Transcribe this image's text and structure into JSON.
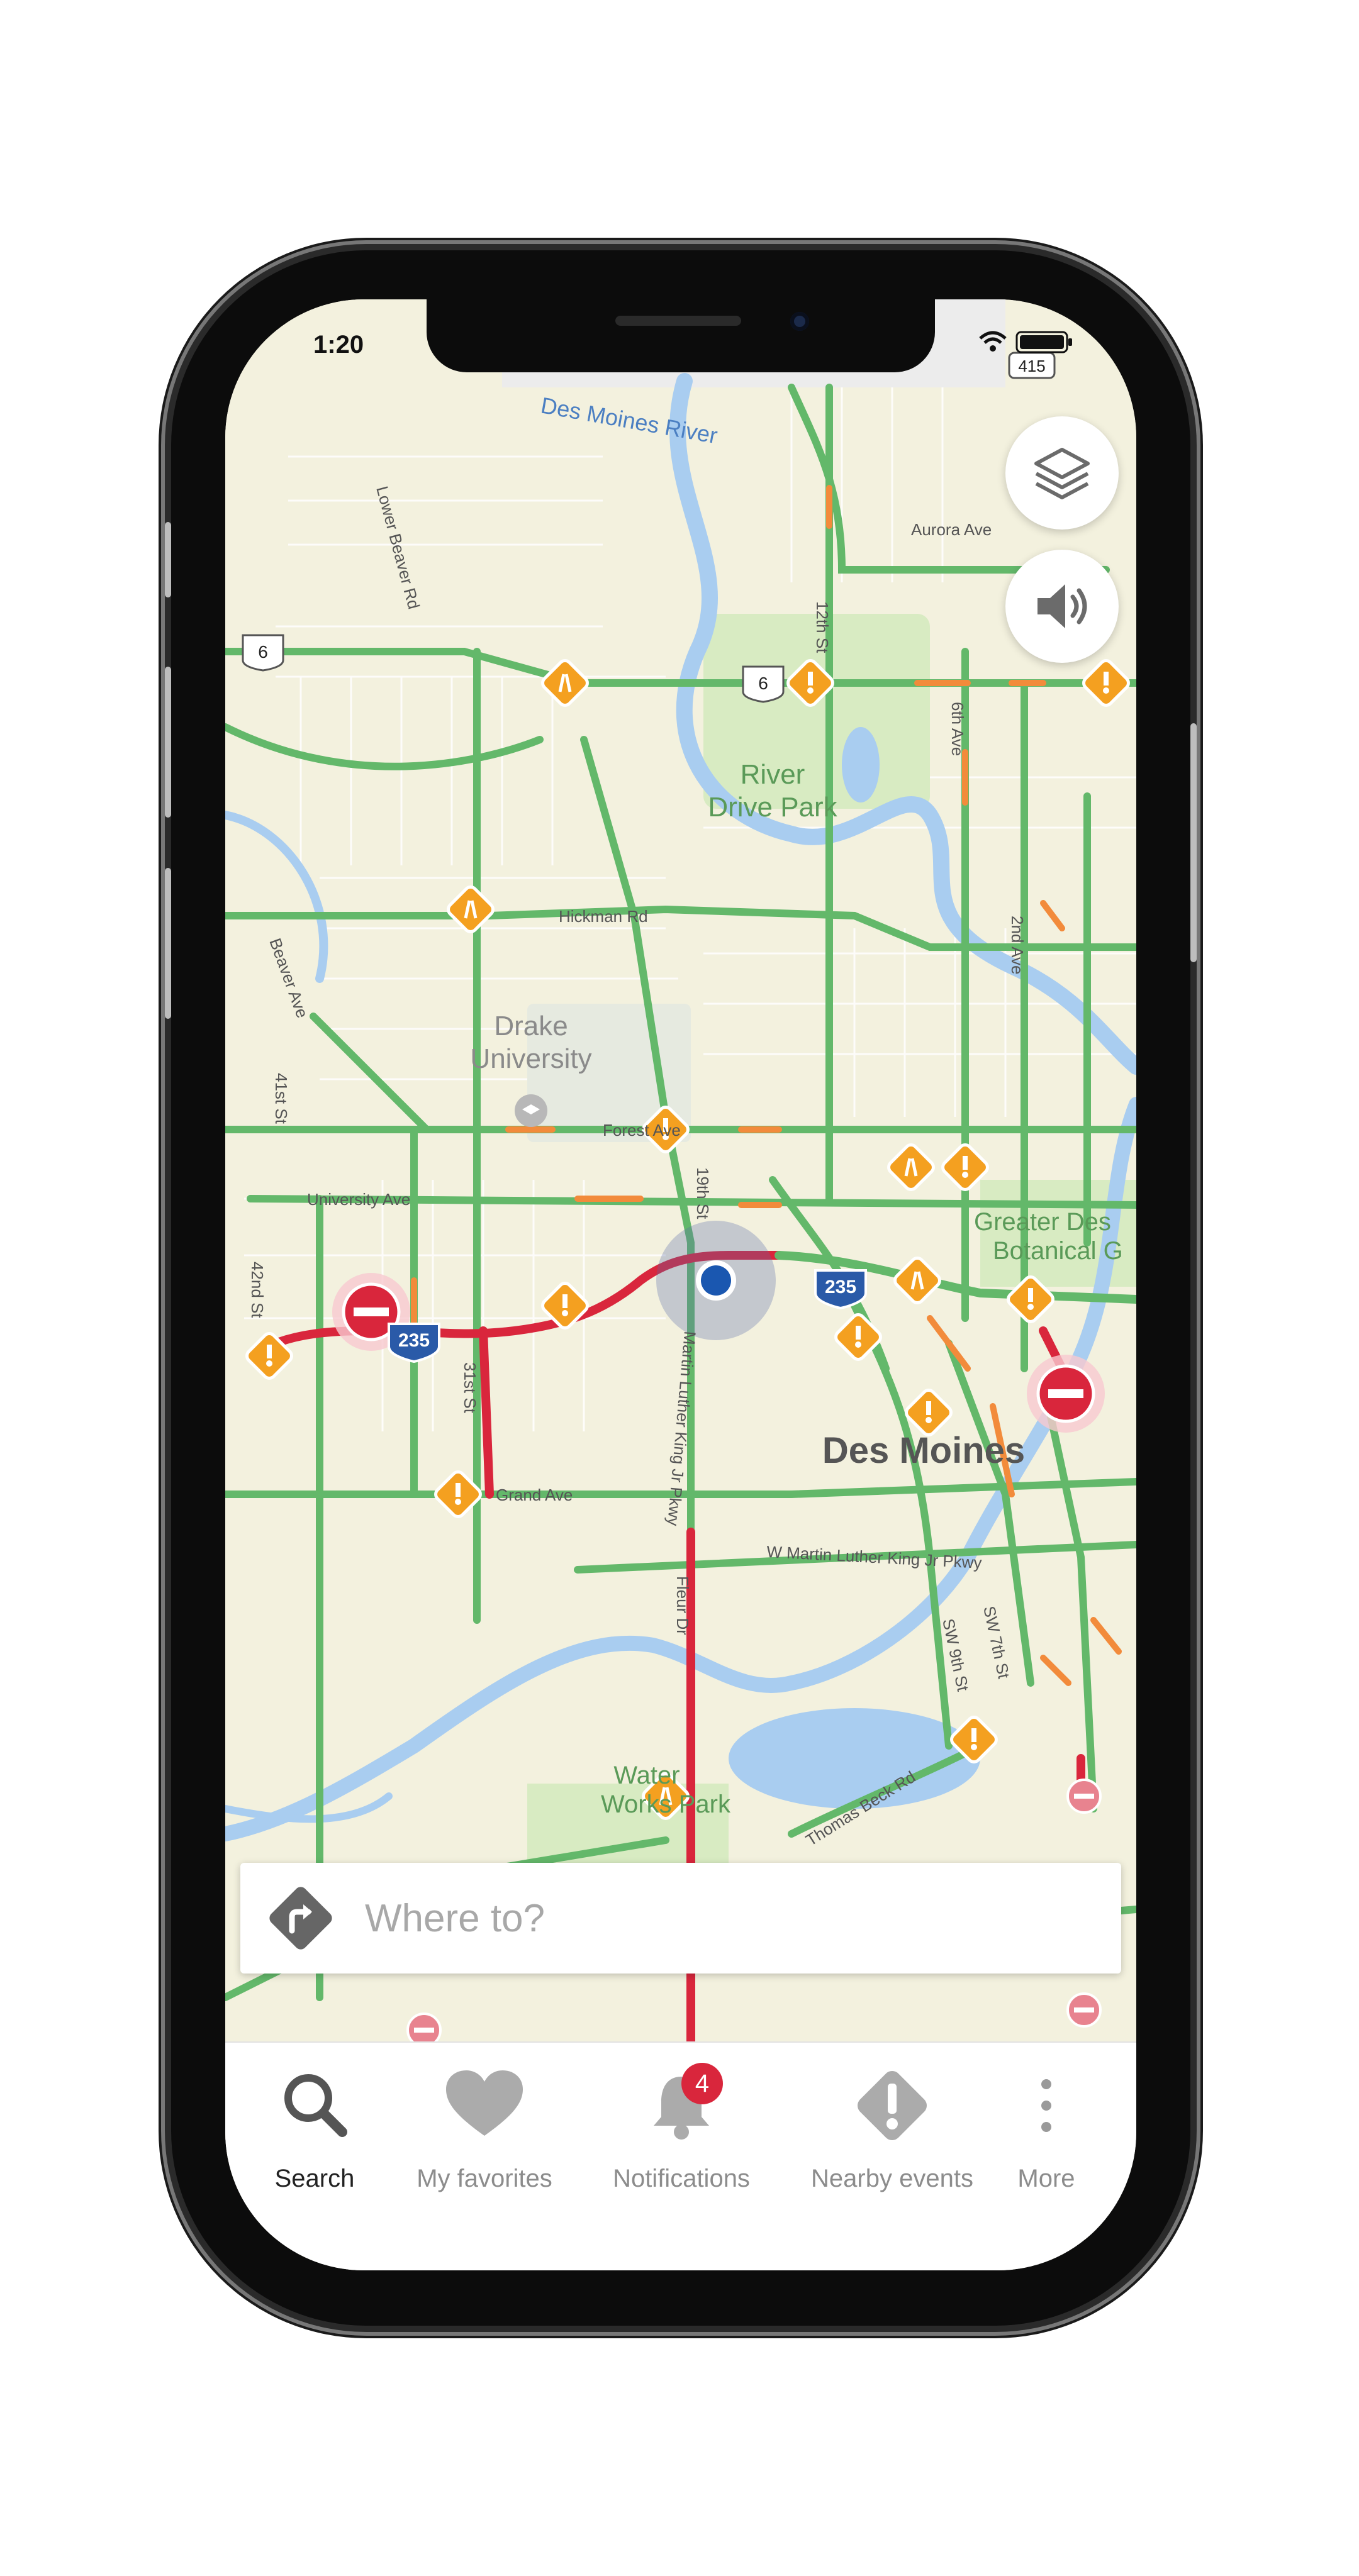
{
  "status_bar": {
    "time": "1:20"
  },
  "map": {
    "labels": {
      "river": "Des Moines River",
      "park1": "River",
      "park1b": "Drive Park",
      "univ1": "Drake",
      "univ1b": "University",
      "hickman": "Hickman Rd",
      "forest": "Forest Ave",
      "university_ave": "University Ave",
      "grand": "Grand Ave",
      "aurora": "Aurora Ave",
      "st12": "12th St",
      "st6": "6th Ave",
      "st2": "2nd Ave",
      "beaver": "Beaver Ave",
      "lower_beaver": "Lower Beaver Rd",
      "st41": "41st St",
      "st42": "42nd St",
      "st31": "31st St",
      "st19": "19th St",
      "mlk": "Martin Luther King Jr Pkwy",
      "wmlk": "W Martin Luther King Jr Pkwy",
      "city": "Des Moines",
      "garden1": "Greater Des",
      "garden2": "Botanical G",
      "water1": "Water",
      "water2": "Works Park",
      "thomas": "Thomas Beck Rd",
      "sw9": "SW 9th St",
      "sw7": "SW 7th St",
      "fleur": "Fleur Dr",
      "interstate": "235",
      "route6": "6",
      "route415": "415"
    }
  },
  "map_controls": {
    "layers_icon": "layers-icon",
    "audio_icon": "speaker-icon"
  },
  "search": {
    "placeholder": "Where to?"
  },
  "tabs": [
    {
      "label": "Search",
      "icon": "search-icon"
    },
    {
      "label": "My favorites",
      "icon": "heart-icon"
    },
    {
      "label": "Notifications",
      "icon": "bell-icon",
      "badge": "4"
    },
    {
      "label": "Nearby events",
      "icon": "warning-icon"
    },
    {
      "label": "More",
      "icon": "more-vertical-icon"
    }
  ],
  "colors": {
    "map_bg": "#f3f1de",
    "road_green": "#63b86a",
    "road_red": "#d9263c",
    "road_orange": "#f28b3b",
    "water": "#a9cdf0",
    "incident_orange": "#f4a020",
    "location_blue": "#1a57b0"
  }
}
